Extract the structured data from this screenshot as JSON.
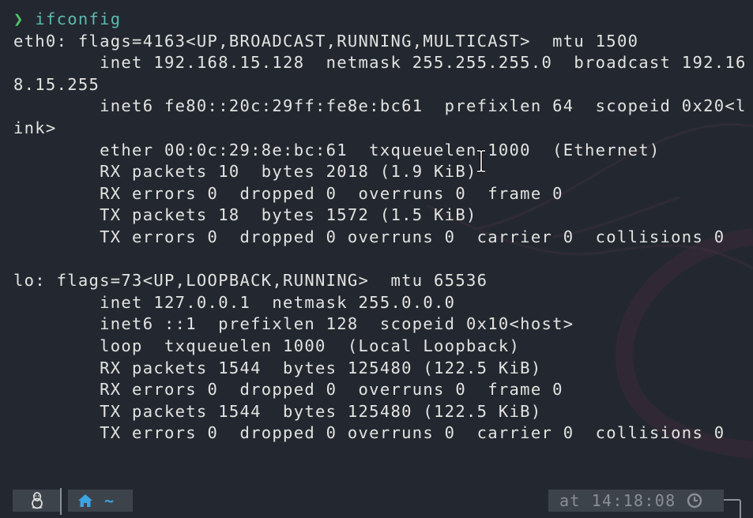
{
  "prompt": {
    "symbol": "❯",
    "command": "ifconfig"
  },
  "output": [
    "eth0: flags=4163<UP,BROADCAST,RUNNING,MULTICAST>  mtu 1500",
    "        inet 192.168.15.128  netmask 255.255.255.0  broadcast 192.16",
    "8.15.255",
    "        inet6 fe80::20c:29ff:fe8e:bc61  prefixlen 64  scopeid 0x20<l",
    "ink>",
    "        ether 00:0c:29:8e:bc:61  txqueuelen 1000  (Ethernet)",
    "        RX packets 10  bytes 2018 (1.9 KiB)",
    "        RX errors 0  dropped 0  overruns 0  frame 0",
    "        TX packets 18  bytes 1572 (1.5 KiB)",
    "        TX errors 0  dropped 0 overruns 0  carrier 0  collisions 0",
    "",
    "lo: flags=73<UP,LOOPBACK,RUNNING>  mtu 65536",
    "        inet 127.0.0.1  netmask 255.0.0.0",
    "        inet6 ::1  prefixlen 128  scopeid 0x10<host>",
    "        loop  txqueuelen 1000  (Local Loopback)",
    "        RX packets 1544  bytes 125480 (122.5 KiB)",
    "        RX errors 0  dropped 0  overruns 0  frame 0",
    "        TX packets 1544  bytes 125480 (122.5 KiB)",
    "        TX errors 0  dropped 0 overruns 0  carrier 0  collisions 0"
  ],
  "statusbar": {
    "os_icon": "linux-tux-icon",
    "dir_icon": "home-icon",
    "dir_label": "~",
    "time_prefix": "at",
    "time": "14:18:08",
    "time_icon": "clock-icon"
  },
  "colors": {
    "background": "#232830",
    "text": "#e3e3e1",
    "prompt_arrow": "#4fc46a",
    "command": "#5fb9b0",
    "dir_accent": "#3ca4e0",
    "segment_bg": "#3d434b",
    "muted": "#8a8f94"
  }
}
